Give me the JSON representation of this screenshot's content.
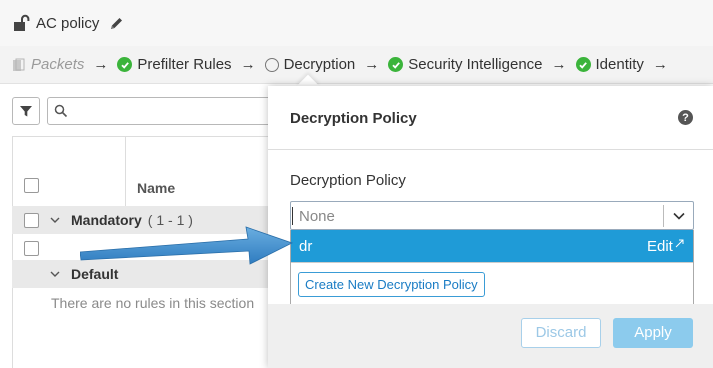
{
  "header": {
    "policy_name": "AC policy",
    "icons": [
      "lock-open-icon",
      "pencil-icon"
    ]
  },
  "flow": {
    "items": [
      {
        "label": "Packets",
        "state": "disabled",
        "icon": "packets-icon"
      },
      {
        "label": "Prefilter Rules",
        "state": "enabled",
        "icon": "check-icon"
      },
      {
        "label": "Decryption",
        "state": "not-configured",
        "icon": "circle-icon"
      },
      {
        "label": "Security Intelligence",
        "state": "enabled",
        "icon": "check-icon"
      },
      {
        "label": "Identity",
        "state": "enabled",
        "icon": "check-icon"
      }
    ],
    "arrow": "→"
  },
  "rules_table": {
    "filter_icon": "filter-icon",
    "search_icon": "search-icon",
    "name_column": "Name",
    "groups": [
      {
        "label": "Mandatory",
        "count": "( 1 - 1 )"
      },
      {
        "label": "Default",
        "count": ""
      }
    ],
    "empty_message": "There are no rules in this section"
  },
  "dialog": {
    "title": "Decryption Policy",
    "help_icon": "?",
    "field_label": "Decryption Policy",
    "selected_value": "None",
    "options": [
      {
        "label": "dr",
        "action": "Edit",
        "highlighted": true
      }
    ],
    "create_button": "Create New Decryption Policy",
    "discard_button": "Discard",
    "apply_button": "Apply"
  },
  "colors": {
    "accent": "#1f9bd7",
    "check_green": "#3bb43b",
    "apply_disabled": "#8ccbed",
    "callout_arrow": "#3f8fd0"
  }
}
